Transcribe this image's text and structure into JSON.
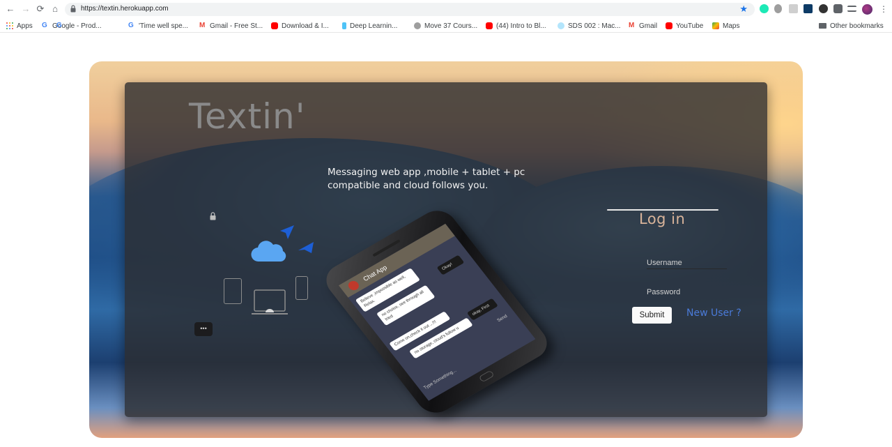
{
  "browser": {
    "url": "https://textin.herokuapp.com",
    "back_icon": "←",
    "forward_icon": "→",
    "reload_icon": "⟳",
    "home_icon": "⌂",
    "star_icon": "★",
    "menu_icon": "⋮",
    "bookmarks": [
      {
        "label": "Apps",
        "icon": "apps-grid-icon"
      },
      {
        "label": "Google - Prod...",
        "icon": "google-icon"
      },
      {
        "label": "'Time well spe...",
        "icon": "google-icon"
      },
      {
        "label": "Gmail - Free St...",
        "icon": "gmail-icon"
      },
      {
        "label": "Download & I...",
        "icon": "youtube-icon"
      },
      {
        "label": "Deep Learnin...",
        "icon": "site-icon"
      },
      {
        "label": "Move 37 Cours...",
        "icon": "site-icon"
      },
      {
        "label": "(44) Intro to Bl...",
        "icon": "youtube-icon"
      },
      {
        "label": "SDS 002 : Mac...",
        "icon": "cloud-site-icon"
      },
      {
        "label": "Gmail",
        "icon": "gmail-icon"
      },
      {
        "label": "YouTube",
        "icon": "youtube-icon"
      },
      {
        "label": "Maps",
        "icon": "maps-icon"
      }
    ],
    "other_bookmarks": "Other bookmarks"
  },
  "page": {
    "brand": "Textin'",
    "tagline": "Messaging web app ,mobile + tablet + pc compatible and cloud follows you.",
    "phone": {
      "header": "Chat App",
      "messages": [
        "Believe ,impossible as well, Relax.",
        "no choice, see through all tried",
        "Come on,check it out ...!!!",
        "no storage, cloud's follow u"
      ],
      "dark_messages": [
        "Okay!",
        "okay, First"
      ],
      "input_placeholder": "Type Something...",
      "send": "Send"
    },
    "bubble_dots": "•••"
  },
  "login": {
    "title": "Log in",
    "username_placeholder": "Username",
    "password_placeholder": "Password",
    "submit": "Submit",
    "new_user": "New User ?"
  },
  "colors": {
    "brand_text": "#8a8a8a",
    "login_title": "#d9b49a",
    "new_user_link": "#4a7bd9",
    "cloud": "#5aa6f2",
    "arrow": "#1d5fd6"
  }
}
